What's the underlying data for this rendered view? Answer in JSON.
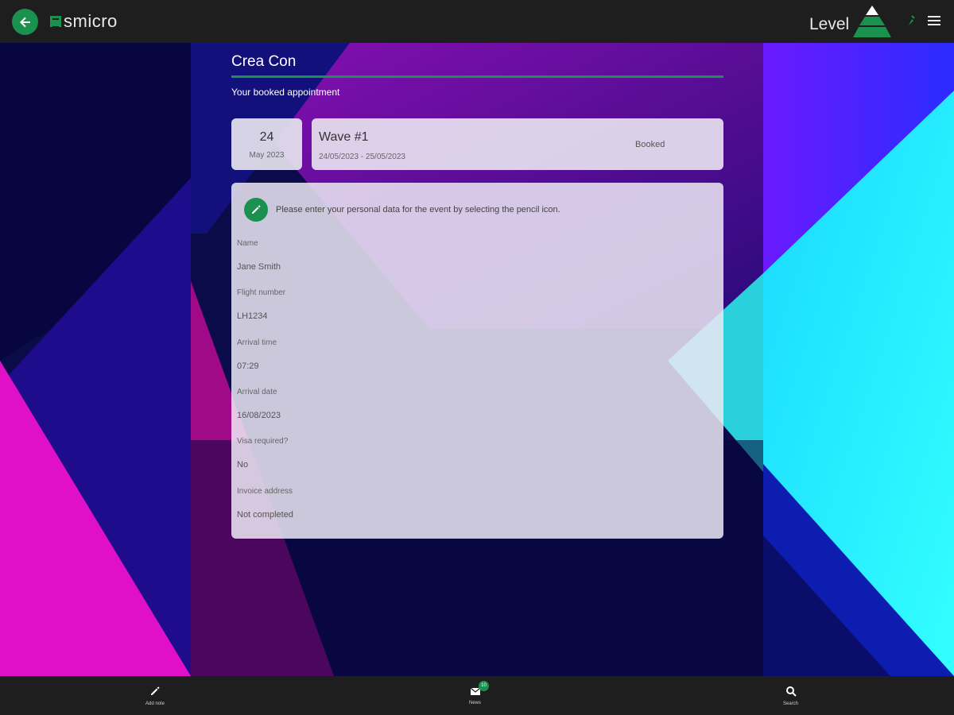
{
  "header": {
    "logo_text": "smicro",
    "level_label": "Level",
    "icons": [
      "back-arrow-icon",
      "level-pyramid-icon",
      "pin-icon",
      "menu-icon"
    ]
  },
  "event": {
    "title": "Crea Con",
    "subtitle": "Your booked appointment"
  },
  "appointment": {
    "day": "24",
    "month_year": "May 2023",
    "name": "Wave #1",
    "date_range": "24/05/2023 - 25/05/2023",
    "status": "Booked"
  },
  "personal_data": {
    "hint": "Please enter your personal data for the event by selecting the pencil icon.",
    "fields": [
      {
        "label": "Name",
        "value": "Jane Smith"
      },
      {
        "label": "Flight number",
        "value": "LH1234"
      },
      {
        "label": "Arrival time",
        "value": "07:29"
      },
      {
        "label": "Arrival date",
        "value": "16/08/2023"
      },
      {
        "label": "Visa required?",
        "value": "No"
      },
      {
        "label": "Invoice address",
        "value": "Not completed"
      }
    ]
  },
  "bottom_nav": {
    "items": [
      {
        "label": "Add note",
        "icon": "pencil-icon"
      },
      {
        "label": "News",
        "icon": "mail-icon",
        "badge": "10"
      },
      {
        "label": "Search",
        "icon": "search-icon"
      }
    ]
  },
  "colors": {
    "accent": "#1b9150",
    "bar_bg": "#1e1e1e",
    "card_bg": "#ece8f4"
  }
}
